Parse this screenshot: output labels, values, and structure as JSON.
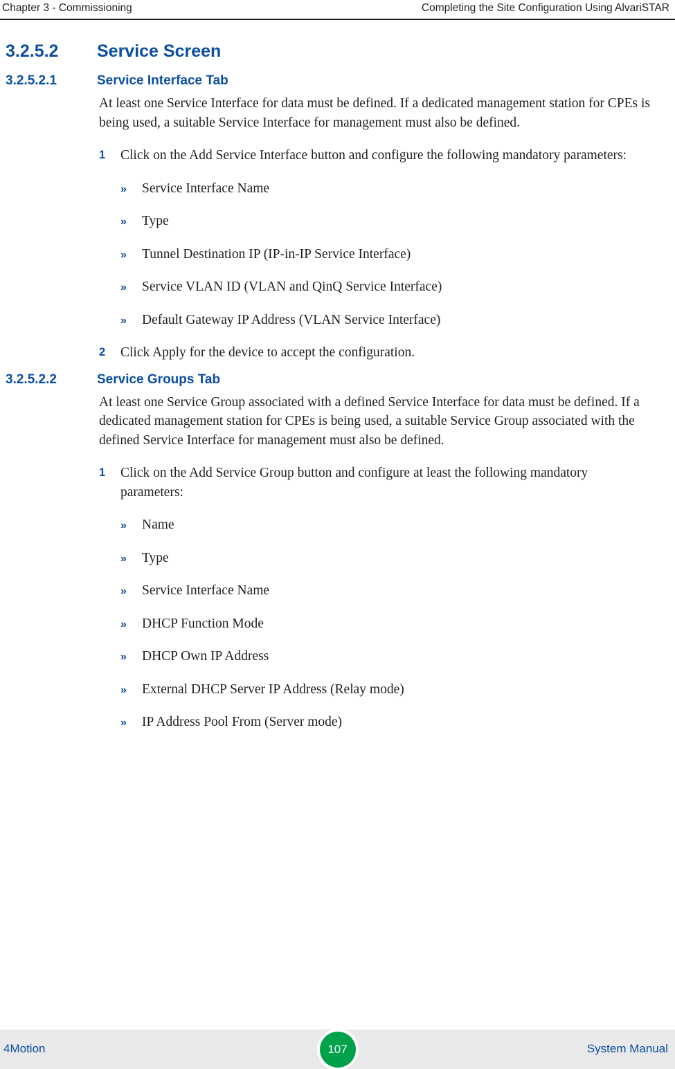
{
  "header": {
    "left": "Chapter 3 - Commissioning",
    "right": "Completing the Site Configuration Using AlvariSTAR"
  },
  "section": {
    "number": "3.2.5.2",
    "title": "Service Screen"
  },
  "subsections": [
    {
      "number": "3.2.5.2.1",
      "title": "Service Interface Tab",
      "intro": "At least one Service Interface for data must be defined. If a dedicated management station for CPEs is being used, a suitable Service Interface for management must also be defined.",
      "steps": [
        {
          "num": "1",
          "text": "Click on the Add Service Interface button and configure the following mandatory parameters:",
          "bullets": [
            "Service Interface Name",
            "Type",
            "Tunnel Destination IP (IP-in-IP Service Interface)",
            "Service VLAN ID (VLAN and QinQ Service Interface)",
            "Default Gateway IP Address (VLAN Service Interface)"
          ]
        },
        {
          "num": "2",
          "text": "Click Apply for the device to accept the configuration.",
          "bullets": []
        }
      ]
    },
    {
      "number": "3.2.5.2.2",
      "title": "Service Groups Tab",
      "intro": "At least one Service Group associated with a defined Service Interface for data must be defined. If a dedicated management station for CPEs is being used, a suitable Service Group associated with the defined Service Interface for management must also be defined.",
      "steps": [
        {
          "num": "1",
          "text": "Click on the Add Service Group button and configure at least the following mandatory parameters:",
          "bullets": [
            "Name",
            "Type",
            "Service Interface Name",
            "DHCP Function Mode",
            "DHCP Own IP Address",
            "External DHCP Server IP Address (Relay mode)",
            "IP Address Pool From (Server mode)"
          ]
        }
      ]
    }
  ],
  "bullet_marker": "»",
  "footer": {
    "left": "4Motion",
    "page": "107",
    "right": "System Manual"
  },
  "colors": {
    "heading_blue": "#0b4ea2",
    "page_badge_green": "#00a14b",
    "footer_bg": "#e9e9e9",
    "text": "#231f20"
  }
}
